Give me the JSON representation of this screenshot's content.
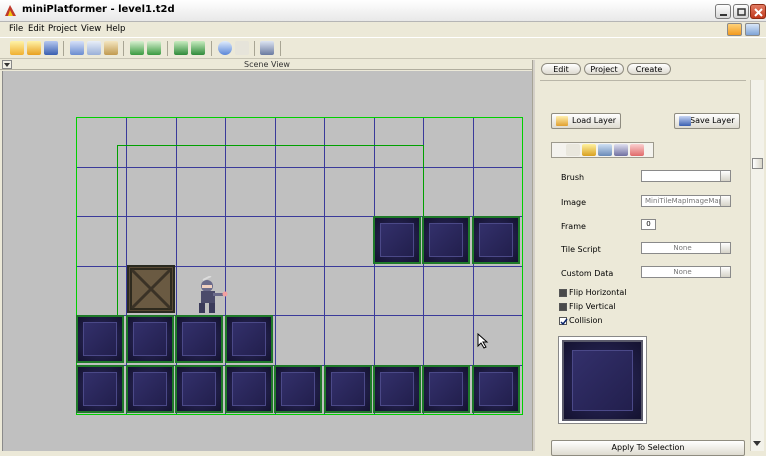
{
  "window": {
    "title": "miniPlatformer - level1.t2d"
  },
  "menu": [
    "File",
    "Edit",
    "Project",
    "View",
    "Help"
  ],
  "scene": {
    "title": "Scene View"
  },
  "tabs": {
    "edit": "Edit",
    "project": "Project",
    "create": "Create"
  },
  "layer": {
    "load": "Load Layer",
    "save": "Save Layer"
  },
  "props": {
    "brush_label": "Brush",
    "brush_value": "",
    "image_label": "Image",
    "image_value": "MiniTileMapImageMap",
    "frame_label": "Frame",
    "frame_value": "0",
    "tile_script_label": "Tile Script",
    "tile_script_value": "None",
    "custom_data_label": "Custom Data",
    "custom_data_value": "None"
  },
  "options": {
    "flip_h": "Flip Horizontal",
    "flip_v": "Flip Vertical",
    "collision": "Collision"
  },
  "apply": "Apply To Selection"
}
